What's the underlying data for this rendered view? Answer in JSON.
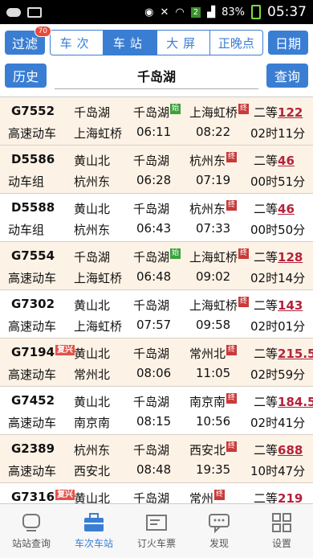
{
  "status": {
    "battery": "83%",
    "time": "05:37",
    "sim": "2"
  },
  "toolbar": {
    "filter_label": "过滤",
    "filter_badge": "70",
    "tabs": [
      {
        "label": "车次",
        "active": false
      },
      {
        "label": "车站",
        "active": true
      },
      {
        "label": "大屏",
        "active": false
      },
      {
        "label": "正晚点",
        "active": false
      }
    ],
    "date_label": "日期",
    "history_label": "历史",
    "search_value": "千岛湖",
    "query_label": "查询"
  },
  "trains": [
    {
      "code": "G7552",
      "type": "高速动车",
      "from": "千岛湖",
      "from_tag": "",
      "board": "千岛湖",
      "board_tag": "始",
      "to": "上海虹桥",
      "to_tag": "终",
      "to2": "上海虹桥",
      "dep": "06:11",
      "arr": "08:22",
      "seat": "二等",
      "price": "122",
      "duration": "02时11分",
      "shade": true
    },
    {
      "code": "D5586",
      "type": "动车组",
      "from": "黄山北",
      "from_tag": "",
      "board": "千岛湖",
      "board_tag": "",
      "to": "杭州东",
      "to_tag": "终",
      "to2": "杭州东",
      "dep": "06:28",
      "arr": "07:19",
      "seat": "二等",
      "price": "46",
      "duration": "00时51分",
      "shade": true
    },
    {
      "code": "D5588",
      "type": "动车组",
      "from": "黄山北",
      "from_tag": "",
      "board": "千岛湖",
      "board_tag": "",
      "to": "杭州东",
      "to_tag": "终",
      "to2": "杭州东",
      "dep": "06:43",
      "arr": "07:33",
      "seat": "二等",
      "price": "46",
      "duration": "00时50分",
      "shade": false
    },
    {
      "code": "G7554",
      "type": "高速动车",
      "from": "千岛湖",
      "from_tag": "",
      "board": "千岛湖",
      "board_tag": "始",
      "to": "上海虹桥",
      "to_tag": "终",
      "to2": "上海虹桥",
      "dep": "06:48",
      "arr": "09:02",
      "seat": "二等",
      "price": "128",
      "duration": "02时14分",
      "shade": true
    },
    {
      "code": "G7302",
      "type": "高速动车",
      "from": "黄山北",
      "from_tag": "",
      "board": "千岛湖",
      "board_tag": "",
      "to": "上海虹桥",
      "to_tag": "终",
      "to2": "上海虹桥",
      "dep": "07:57",
      "arr": "09:58",
      "seat": "二等",
      "price": "143",
      "duration": "02时01分",
      "shade": false
    },
    {
      "code": "G7194",
      "code_tag": "复兴",
      "type": "高速动车",
      "from": "黄山北",
      "from_tag": "",
      "board": "千岛湖",
      "board_tag": "",
      "to": "常州北",
      "to_tag": "终",
      "to2": "常州北",
      "dep": "08:06",
      "arr": "11:05",
      "seat": "二等",
      "price": "215.5",
      "duration": "02时59分",
      "shade": true
    },
    {
      "code": "G7452",
      "type": "高速动车",
      "from": "黄山北",
      "from_tag": "",
      "board": "千岛湖",
      "board_tag": "",
      "to": "南京南",
      "to_tag": "终",
      "to2": "南京南",
      "dep": "08:15",
      "arr": "10:56",
      "seat": "二等",
      "price": "184.5",
      "duration": "02时41分",
      "shade": false
    },
    {
      "code": "G2389",
      "type": "高速动车",
      "from": "杭州东",
      "from_tag": "",
      "board": "千岛湖",
      "board_tag": "",
      "to": "西安北",
      "to_tag": "终",
      "to2": "西安北",
      "dep": "08:48",
      "arr": "19:35",
      "seat": "二等",
      "price": "688",
      "duration": "10时47分",
      "shade": true
    },
    {
      "code": "G7316",
      "code_tag": "复兴",
      "type": "",
      "from": "黄山北",
      "from_tag": "",
      "board": "千岛湖",
      "board_tag": "",
      "to": "常州",
      "to_tag": "终",
      "to2": "",
      "dep": "",
      "arr": "",
      "seat": "二等",
      "price": "219",
      "duration": "",
      "shade": false
    }
  ],
  "bottom_nav": [
    {
      "label": "站站查询",
      "icon": "train-icon",
      "active": false
    },
    {
      "label": "车次车站",
      "icon": "briefcase-icon",
      "active": true
    },
    {
      "label": "订火车票",
      "icon": "ticket-icon",
      "active": false
    },
    {
      "label": "发现",
      "icon": "chat-bubble-icon",
      "active": false
    },
    {
      "label": "设置",
      "icon": "grid-icon",
      "active": false
    }
  ]
}
